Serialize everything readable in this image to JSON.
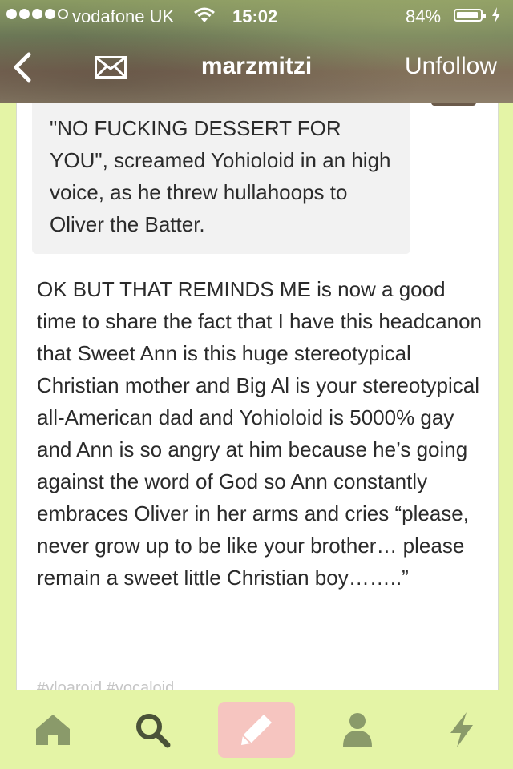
{
  "status_bar": {
    "carrier": "vodafone UK",
    "time": "15:02",
    "battery": "84%",
    "signal_bars_filled": 4,
    "signal_bars_total": 5
  },
  "nav": {
    "back_icon": "chevron-left-icon",
    "mail_icon": "envelope-icon",
    "title": "marzmitzi",
    "unfollow_label": "Unfollow"
  },
  "post": {
    "quote": "\"NO FUCKING DESSERT FOR YOU\", screamed Yohioloid in an high voice, as he threw hullahoops to Oliver the Batter.",
    "body": "OK BUT THAT REMINDS ME is now a good time to share the fact that I have this headcanon that Sweet Ann is this huge stereotypical Christian mother and Big Al is your stereotypical all-American dad and Yohioloid is 5000% gay and Ann is so angry at him because he’s going against the word of God so Ann constantly embraces Oliver in her arms and cries “please, never grow up to be like your brother… please remain a sweet little Christian boy……..”",
    "tags": "#vloaroid #vocaloid"
  },
  "tabbar": {
    "items": [
      "home-icon",
      "search-icon",
      "pencil-icon",
      "person-icon",
      "lightning-icon"
    ]
  },
  "colors": {
    "background": "#e4f4a6",
    "compose_button": "#f6c5c0",
    "icon": "#8a9a6a",
    "icon_active": "#4a5238"
  }
}
